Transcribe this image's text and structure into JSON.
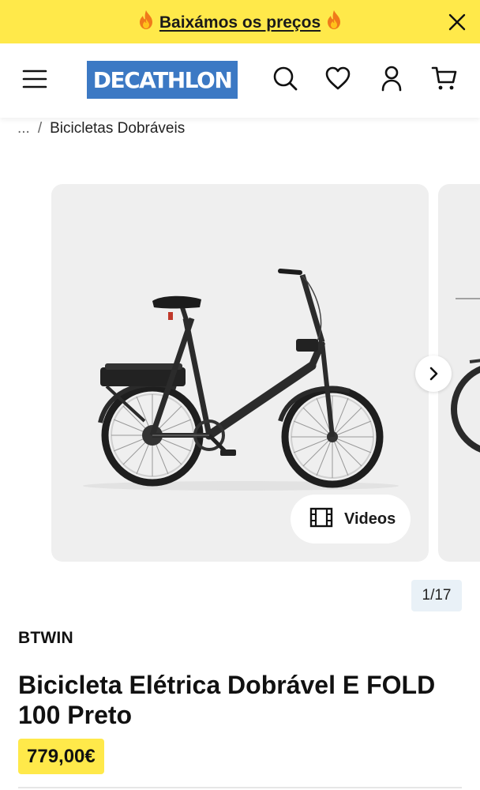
{
  "promo": {
    "text": "Baixámos os preços",
    "icon_left": "fire-icon",
    "icon_right": "fire-icon",
    "close_icon": "close-icon",
    "background": "#ffe94a"
  },
  "header": {
    "menu_icon": "hamburger-menu-icon",
    "logo": "DECATHLON",
    "logo_color": "#3c79c4",
    "icons": [
      "search-icon",
      "heart-icon",
      "user-icon",
      "cart-icon"
    ]
  },
  "breadcrumb": {
    "ellipsis": "...",
    "separator": "/",
    "current": "Bicicletas Dobráveis"
  },
  "gallery": {
    "next_icon": "chevron-right-icon",
    "videos_label": "Videos",
    "videos_icon": "film-icon",
    "counter": "1/17"
  },
  "product": {
    "brand": "BTWIN",
    "title": "Bicicleta Elétrica Dobrável E FOLD 100 Preto",
    "price": "779,00€",
    "price_highlight": "#ffe94a"
  }
}
